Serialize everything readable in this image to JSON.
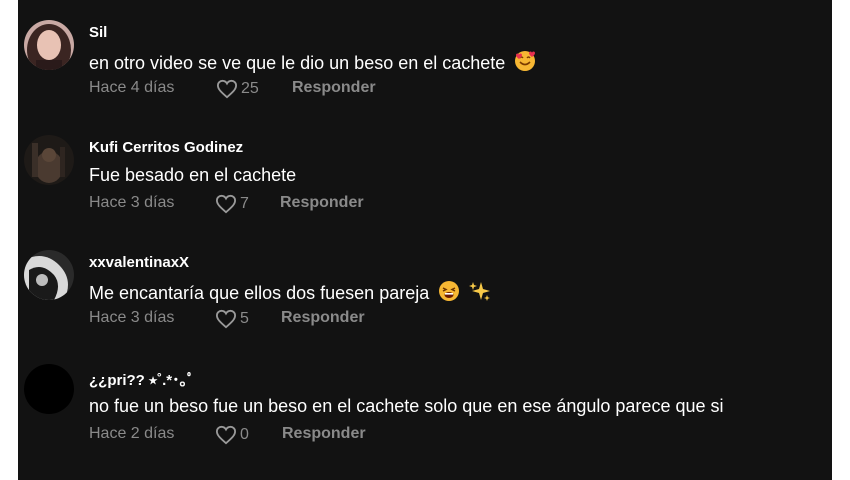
{
  "comments": [
    {
      "username": "Sil",
      "text": "en otro video se ve que le dio un beso en el cachete",
      "emojis": [
        "smiling-face-with-hearts"
      ],
      "time": "Hace 4 días",
      "likes": "25",
      "reply_label": "Responder"
    },
    {
      "username": "Kufi Cerritos Godinez",
      "text": "Fue besado en el cachete",
      "emojis": [],
      "time": "Hace 3 días",
      "likes": "7",
      "reply_label": "Responder"
    },
    {
      "username": "xxvalentinaxX",
      "text": "Me encantaría que ellos dos fuesen pareja",
      "emojis": [
        "tired-face",
        "sparkles"
      ],
      "time": "Hace 3 días",
      "likes": "5",
      "reply_label": "Responder"
    },
    {
      "username": "¿¿pri?? ⭒˚.*･｡ﾟ",
      "text": "no fue un beso fue un beso en el cachete solo que en ese ángulo parece que si",
      "emojis": [],
      "time": "Hace 2 días",
      "likes": "0",
      "reply_label": "Responder"
    }
  ],
  "colors": {
    "background": "#121212",
    "primary_text": "#ffffff",
    "secondary_text": "#8a8a8a"
  }
}
